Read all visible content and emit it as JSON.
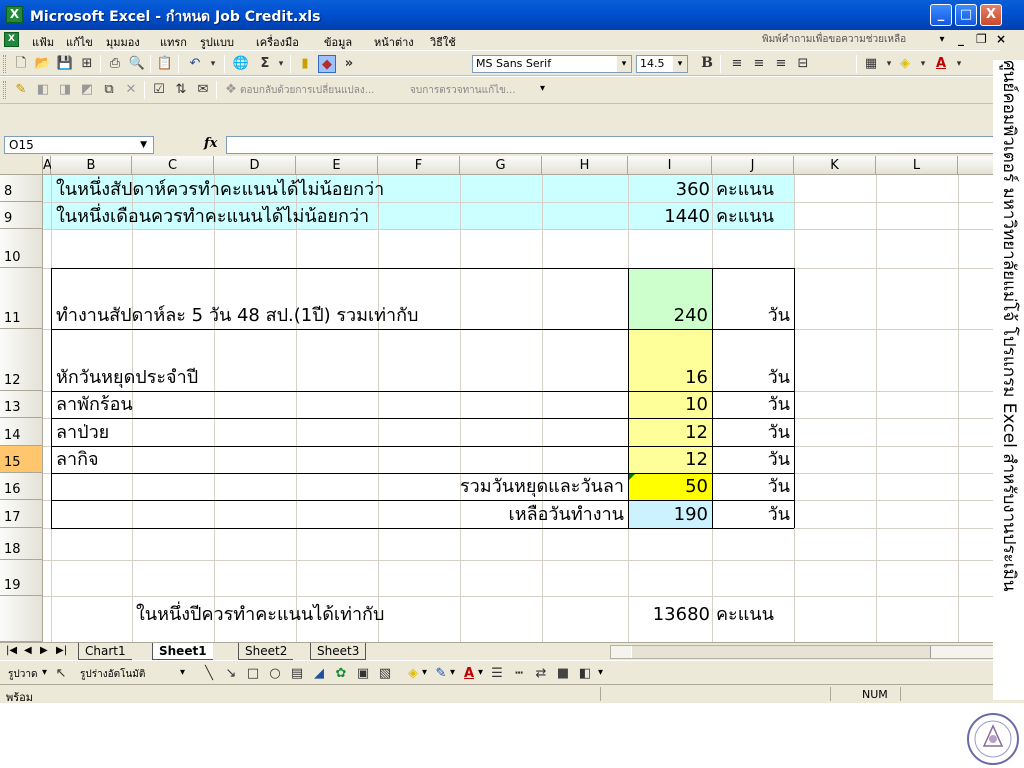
{
  "window": {
    "title": "Microsoft Excel - กำหนด Job Credit.xls",
    "app_icon": "X",
    "buttons": {
      "minimize": "_",
      "maximize": "□",
      "close": "X"
    }
  },
  "menu": {
    "items": [
      "แฟ้ม",
      "แก้ไข",
      "มุมมอง",
      "แทรก",
      "รูปแบบ",
      "เครื่องมือ",
      "ข้อมูล",
      "หน้าต่าง",
      "วิธีใช้"
    ],
    "help_placeholder": "พิมพ์คำถามเพื่อขอความช่วยเหลือ",
    "mdi_controls": [
      "_",
      "ð",
      "×"
    ]
  },
  "toolbar": {
    "font_name": "MS Sans Serif",
    "font_size": "14.5",
    "bold_label": "B",
    "sigma_label": "Σ",
    "more_label": "»",
    "review_text_1": "ตอบกลับด้วยการเปลี่ยนแปลง...",
    "review_text_2": "จบการตรวจทานแก้ไข..."
  },
  "formula_bar": {
    "name_box": "O15",
    "fx_label": "fx",
    "content": ""
  },
  "grid": {
    "columns": [
      "A",
      "B",
      "C",
      "D",
      "E",
      "F",
      "G",
      "H",
      "I",
      "J",
      "K",
      "L"
    ],
    "rows": [
      "8",
      "9",
      "10",
      "11",
      "12",
      "13",
      "14",
      "15",
      "16",
      "17",
      "18",
      "19"
    ],
    "selected_row": "15",
    "cells": {
      "r8_label": "ในหนึ่งสัปดาห์ควรทำคะแนนได้ไม่น้อยกว่า",
      "r8_value": "360",
      "r8_unit": "คะแนน",
      "r9_label": "ในหนึ่งเดือนควรทำคะแนนได้ไม่น้อยกว่า",
      "r9_value": "1440",
      "r9_unit": "คะแนน",
      "r11_label": "ทำงานสัปดาห์ละ 5 วัน  48 สป.(1ปี)  รวมเท่ากับ",
      "r11_value": "240",
      "r11_unit": "วัน",
      "r12_label": "หักวันหยุดประจำปี",
      "r12_value": "16",
      "r12_unit": "วัน",
      "r13_label": "ลาพักร้อน",
      "r13_value": "10",
      "r13_unit": "วัน",
      "r14_label": "ลาป่วย",
      "r14_value": "12",
      "r14_unit": "วัน",
      "r15_label": "ลากิจ",
      "r15_value": "12",
      "r15_unit": "วัน",
      "r16_label": "รวมวันหยุดและวันลา",
      "r16_value": "50",
      "r16_unit": "วัน",
      "r17_label": "เหลือวันทำงาน",
      "r17_value": "190",
      "r17_unit": "วัน",
      "r19_label": "ในหนึ่งปีควรทำคะแนนได้เท่ากับ",
      "r19_value": "13680",
      "r19_unit": "คะแนน"
    },
    "colors": {
      "cyan": "#ccffff",
      "green": "#ccffcc",
      "yellow": "#ffff99",
      "bright_yellow": "#ffff00",
      "light_blue": "#ccf2ff"
    }
  },
  "sheets": {
    "tabs": [
      "Chart1",
      "Sheet1",
      "Sheet2",
      "Sheet3"
    ],
    "active": "Sheet1"
  },
  "drawing_toolbar": {
    "draw_label": "รูปวาด",
    "autoshape_label": "รูปร่างอัตโนมัติ"
  },
  "status": {
    "text": "พร้อม",
    "num_lock": "NUM"
  },
  "side_text": "ศูนย์คอมพิวเตอร์ มหาวิทยาลัยแม่โจ้ โปรแกรม Excel สำหรับงานประเมิน"
}
